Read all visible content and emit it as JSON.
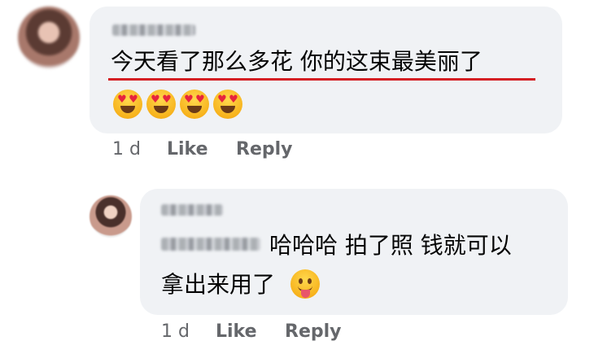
{
  "comment": {
    "text": "今天看了那么多花 你的这束最美丽了",
    "emojis": [
      "heart-eyes",
      "heart-eyes",
      "heart-eyes",
      "heart-eyes"
    ],
    "time": "1 d",
    "like_label": "Like",
    "reply_label": "Reply",
    "underline_color": "#d41f23"
  },
  "reply": {
    "text_line1": "哈哈哈 拍了照 钱就可以",
    "text_line2": "拿出来用了",
    "emoji": "tongue-out",
    "time": "1 d",
    "like_label": "Like",
    "reply_label": "Reply"
  },
  "colors": {
    "bubble": "#f0f2f5",
    "meta": "#65676b",
    "text": "#050505"
  }
}
